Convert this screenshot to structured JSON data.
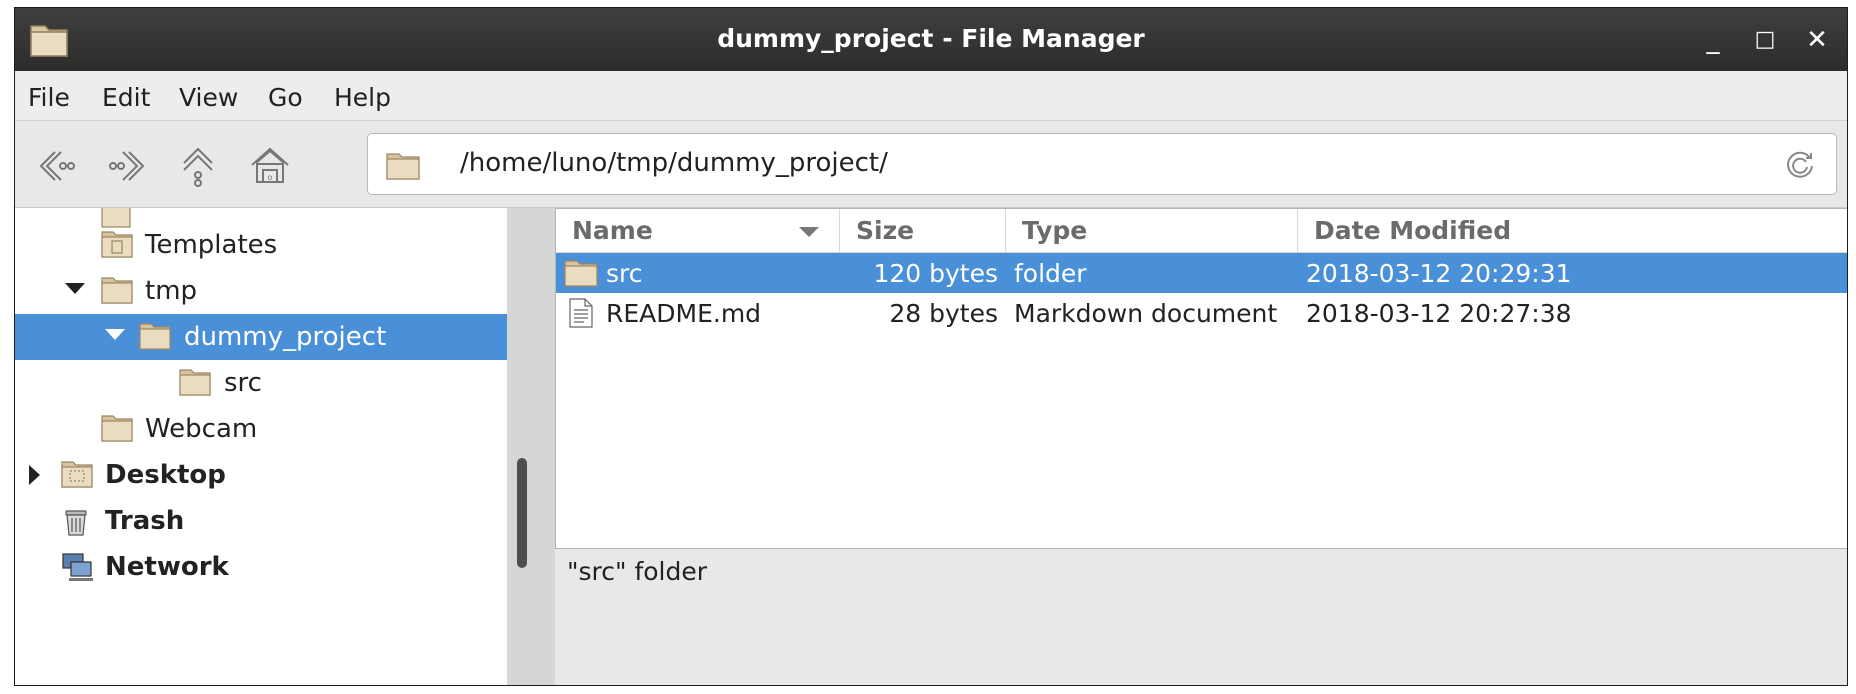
{
  "window": {
    "title": "dummy_project - File Manager"
  },
  "window_controls": {
    "minimize": "_",
    "maximize": "□",
    "close": "✕"
  },
  "menubar": {
    "items": [
      "File",
      "Edit",
      "View",
      "Go",
      "Help"
    ]
  },
  "toolbar": {
    "back_icon": "back-arrow-icon",
    "forward_icon": "forward-arrow-icon",
    "up_icon": "up-arrow-icon",
    "home_icon": "home-icon",
    "location": "/home/luno/tmp/dummy_project/",
    "reload_icon": "reload-icon"
  },
  "sidebar": {
    "items": [
      {
        "label": "Templates",
        "icon": "templates-folder-icon",
        "bold": false,
        "expander": "none"
      },
      {
        "label": "tmp",
        "icon": "folder-icon",
        "bold": false,
        "expander": "expanded"
      },
      {
        "label": "dummy_project",
        "icon": "folder-icon",
        "bold": false,
        "expander": "expanded",
        "selected": true
      },
      {
        "label": "src",
        "icon": "folder-icon",
        "bold": false,
        "expander": "none"
      },
      {
        "label": "Webcam",
        "icon": "folder-icon",
        "bold": false,
        "expander": "none"
      },
      {
        "label": "Desktop",
        "icon": "desktop-folder-icon",
        "bold": true,
        "expander": "collapsed"
      },
      {
        "label": "Trash",
        "icon": "trash-icon",
        "bold": true,
        "expander": "none"
      },
      {
        "label": "Network",
        "icon": "network-icon",
        "bold": true,
        "expander": "none"
      }
    ]
  },
  "filelist": {
    "columns": [
      "Name",
      "Size",
      "Type",
      "Date Modified"
    ],
    "rows": [
      {
        "name": "src",
        "size": "120 bytes",
        "type": "folder",
        "modified": "2018-03-12 20:29:31",
        "icon": "folder-icon",
        "selected": true
      },
      {
        "name": "README.md",
        "size": "28 bytes",
        "type": "Markdown document",
        "modified": "2018-03-12 20:27:38",
        "icon": "text-file-icon",
        "selected": false
      }
    ]
  },
  "statusbar": {
    "text": "\"src\" folder"
  },
  "colors": {
    "accent": "#4a90d9",
    "titlebar": "#353534",
    "folder": "#e9dcc4"
  }
}
